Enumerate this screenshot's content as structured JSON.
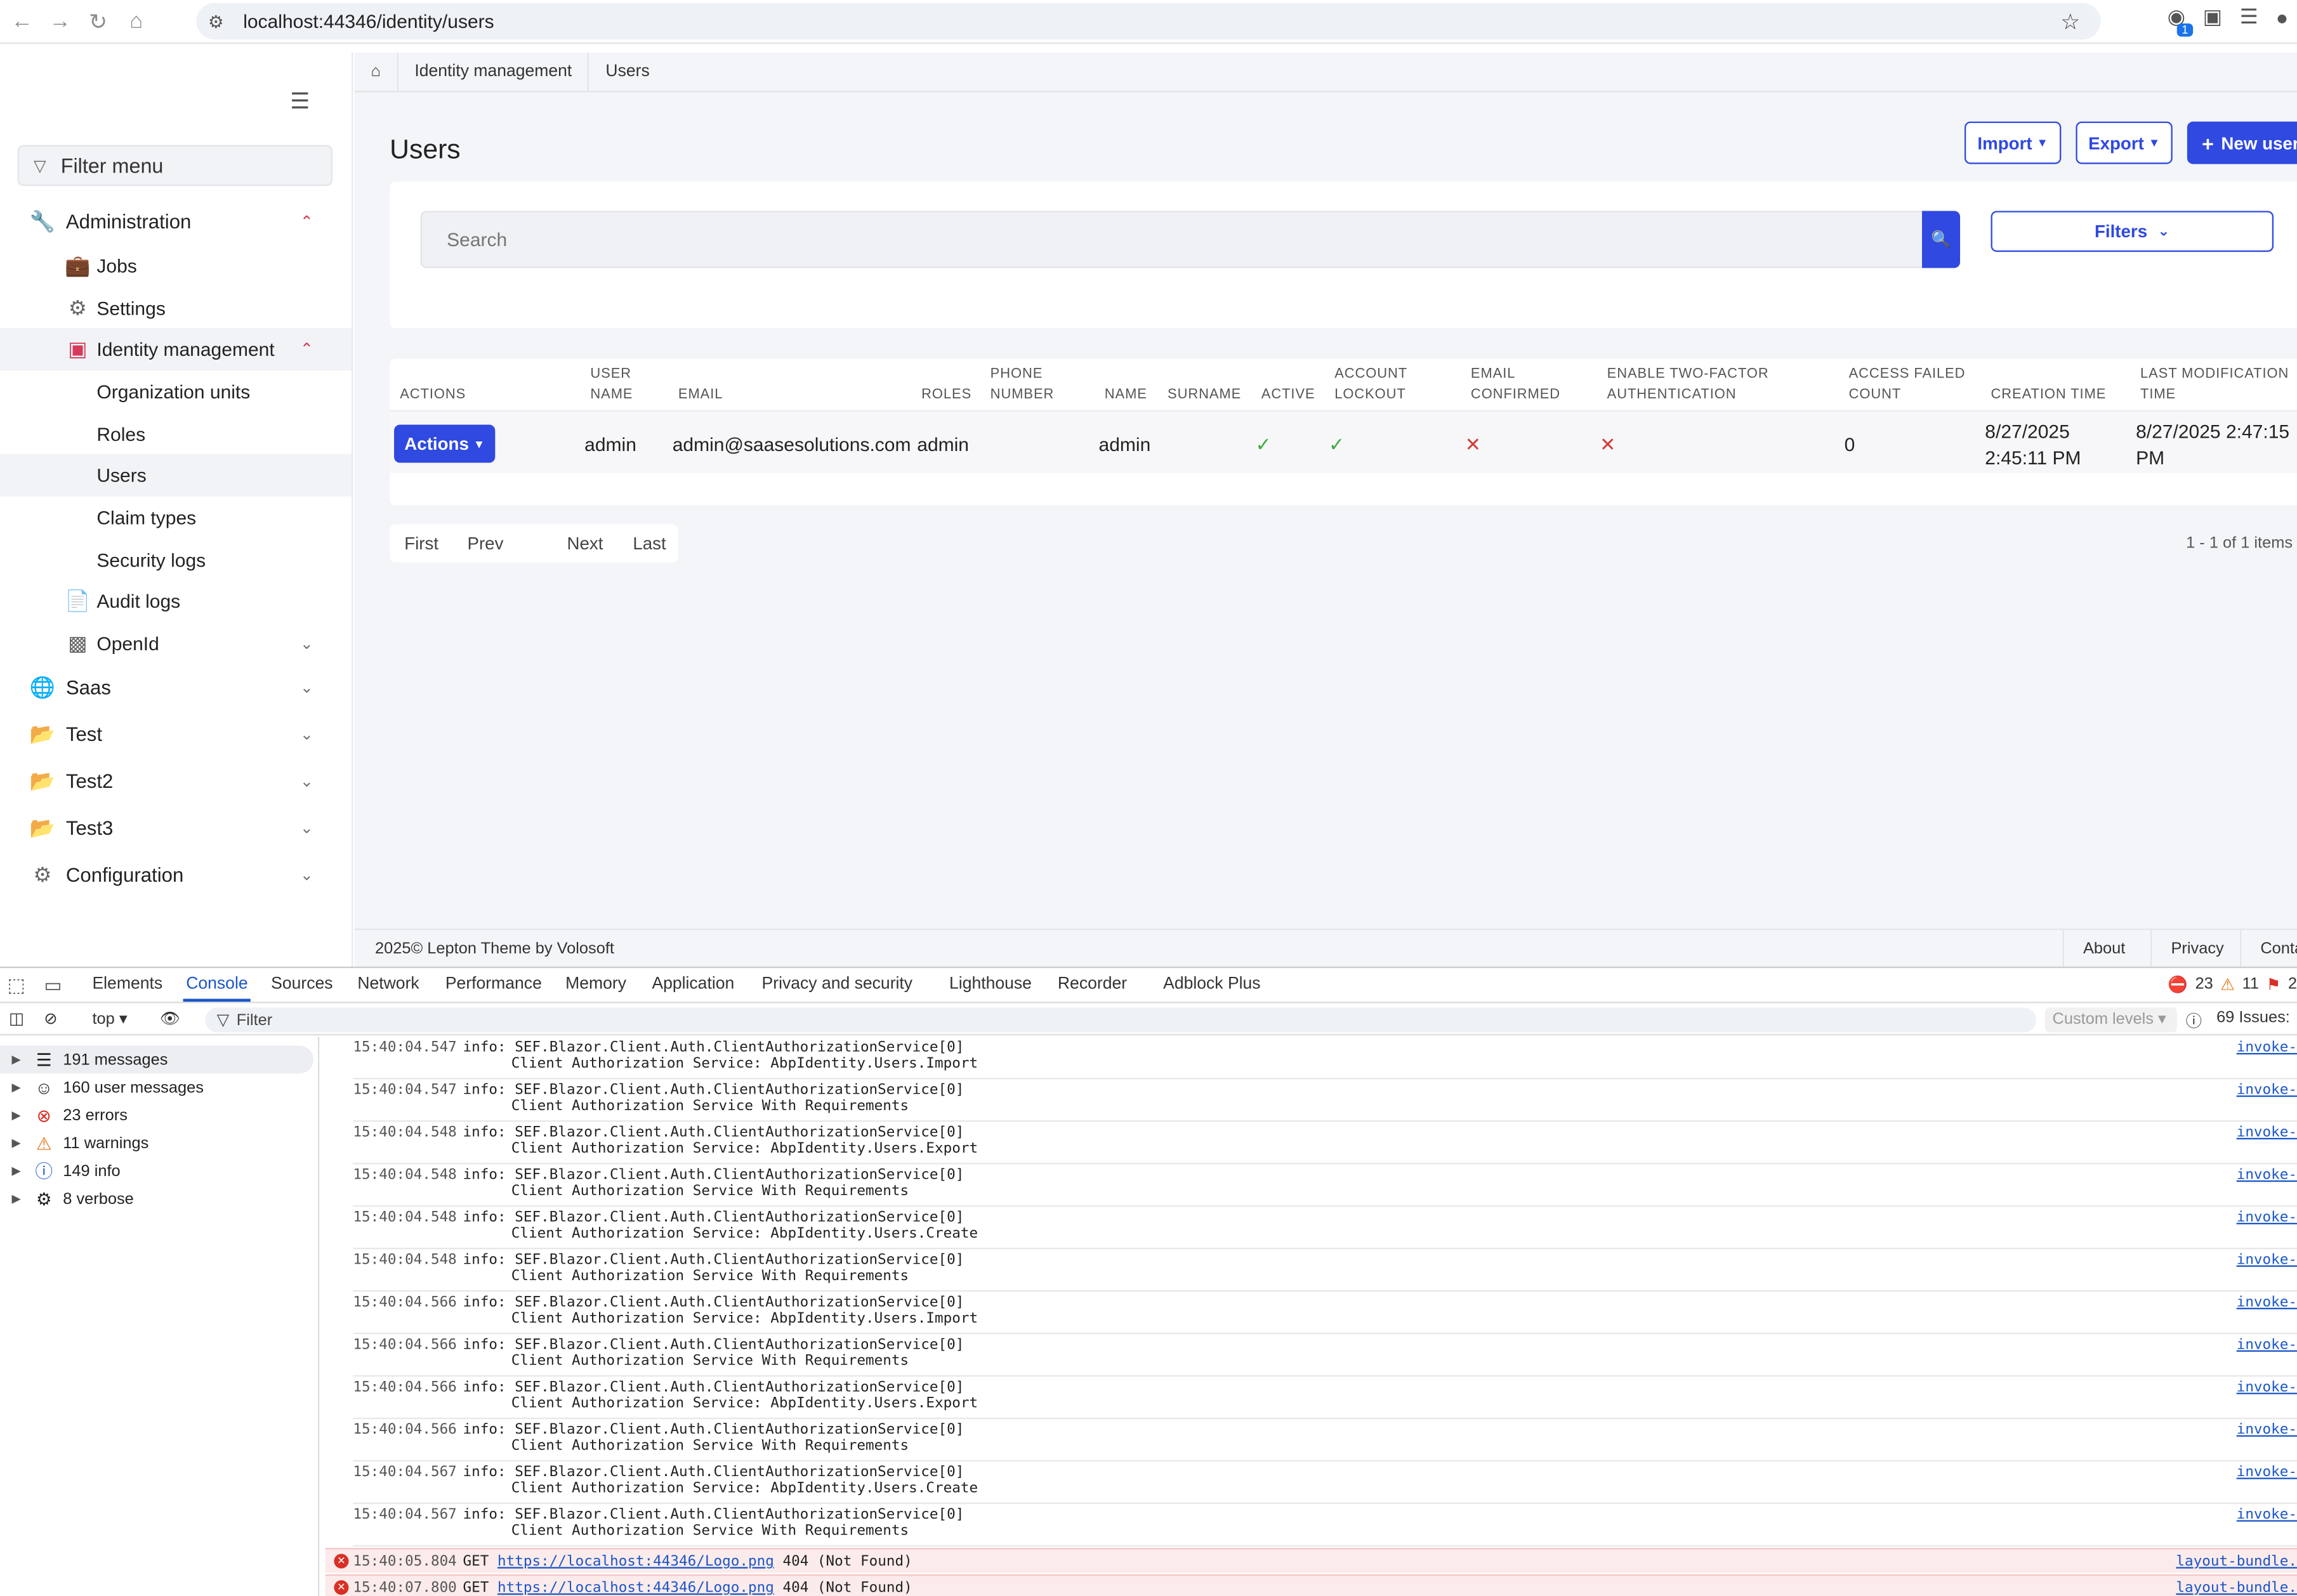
{
  "browser": {
    "url": "localhost:44346/identity/users",
    "extension_badge": "1"
  },
  "sidebar": {
    "filter_placeholder": "Filter menu",
    "items": [
      {
        "label": "Administration"
      },
      {
        "label": "Jobs"
      },
      {
        "label": "Settings"
      },
      {
        "label": "Identity management"
      },
      {
        "label": "Organization units"
      },
      {
        "label": "Roles"
      },
      {
        "label": "Users"
      },
      {
        "label": "Claim types"
      },
      {
        "label": "Security logs"
      },
      {
        "label": "Audit logs"
      },
      {
        "label": "OpenId"
      },
      {
        "label": "Saas"
      },
      {
        "label": "Test"
      },
      {
        "label": "Test2"
      },
      {
        "label": "Test3"
      },
      {
        "label": "Configuration"
      }
    ]
  },
  "breadcrumb": [
    "Identity management",
    "Users"
  ],
  "page": {
    "title": "Users",
    "import_label": "Import",
    "export_label": "Export",
    "new_user_label": "New user",
    "search_placeholder": "Search",
    "filters_label": "Filters"
  },
  "table": {
    "headers": {
      "actions": "ACTIONS",
      "user_name": [
        "USER",
        "NAME"
      ],
      "email": "EMAIL",
      "roles": "ROLES",
      "phone_number": [
        "PHONE",
        "NUMBER"
      ],
      "name": "NAME",
      "surname": "SURNAME",
      "active": "ACTIVE",
      "account_lockout": [
        "ACCOUNT",
        "LOCKOUT"
      ],
      "email_confirmed": [
        "EMAIL",
        "CONFIRMED"
      ],
      "two_factor": [
        "ENABLE TWO-FACTOR",
        "AUTHENTICATION"
      ],
      "access_failed": [
        "ACCESS FAILED",
        "COUNT"
      ],
      "creation_time": "CREATION TIME",
      "last_modification": [
        "LAST MODIFICATION",
        "TIME"
      ]
    },
    "rows": [
      {
        "actions_label": "Actions",
        "user_name": "admin",
        "email": "admin@saasesolutions.com",
        "roles": "admin",
        "phone_number": "",
        "name": "admin",
        "surname": "",
        "active": true,
        "account_lockout": true,
        "email_confirmed": false,
        "two_factor": false,
        "access_failed_count": "0",
        "creation_time": [
          "8/27/2025",
          "2:45:11 PM"
        ],
        "last_modification": [
          "8/27/2025 2:47:15",
          "PM"
        ]
      }
    ]
  },
  "pager": {
    "first": "First",
    "prev": "Prev",
    "next": "Next",
    "last": "Last",
    "summary": "1 - 1 of 1 items"
  },
  "footer": {
    "year": "2025©",
    "theme": "Lepton Theme",
    "by": "by",
    "vendor": "Volosoft",
    "links": [
      "About",
      "Privacy",
      "Conta"
    ]
  },
  "devtools": {
    "tabs": [
      "Elements",
      "Console",
      "Sources",
      "Network",
      "Performance",
      "Memory",
      "Application",
      "Privacy and security",
      "Lighthouse",
      "Recorder",
      "Adblock Plus"
    ],
    "active_tab": "Console",
    "errors_count": "23",
    "warnings_count": "11",
    "issues_count_badge": "2",
    "context": "top",
    "filter_placeholder": "Filter",
    "levels": "Custom levels",
    "issues": "69 Issues:",
    "sidebar": [
      {
        "label": "191 messages"
      },
      {
        "label": "160 user messages"
      },
      {
        "label": "23 errors"
      },
      {
        "label": "11 warnings"
      },
      {
        "label": "149 info"
      },
      {
        "label": "8 verbose"
      }
    ],
    "logs": [
      {
        "ts": "15:40:04.547",
        "l1": "info: SEF.Blazor.Client.Auth.ClientAuthorizationService[0]",
        "l2": "Client Authorization Service: AbpIdentity.Users.Import",
        "src": "invoke-"
      },
      {
        "ts": "15:40:04.547",
        "l1": "info: SEF.Blazor.Client.Auth.ClientAuthorizationService[0]",
        "l2": "Client Authorization Service With Requirements",
        "src": "invoke-"
      },
      {
        "ts": "15:40:04.548",
        "l1": "info: SEF.Blazor.Client.Auth.ClientAuthorizationService[0]",
        "l2": "Client Authorization Service: AbpIdentity.Users.Export",
        "src": "invoke-"
      },
      {
        "ts": "15:40:04.548",
        "l1": "info: SEF.Blazor.Client.Auth.ClientAuthorizationService[0]",
        "l2": "Client Authorization Service With Requirements",
        "src": "invoke-"
      },
      {
        "ts": "15:40:04.548",
        "l1": "info: SEF.Blazor.Client.Auth.ClientAuthorizationService[0]",
        "l2": "Client Authorization Service: AbpIdentity.Users.Create",
        "src": "invoke-"
      },
      {
        "ts": "15:40:04.548",
        "l1": "info: SEF.Blazor.Client.Auth.ClientAuthorizationService[0]",
        "l2": "Client Authorization Service With Requirements",
        "src": "invoke-"
      },
      {
        "ts": "15:40:04.566",
        "l1": "info: SEF.Blazor.Client.Auth.ClientAuthorizationService[0]",
        "l2": "Client Authorization Service: AbpIdentity.Users.Import",
        "src": "invoke-"
      },
      {
        "ts": "15:40:04.566",
        "l1": "info: SEF.Blazor.Client.Auth.ClientAuthorizationService[0]",
        "l2": "Client Authorization Service With Requirements",
        "src": "invoke-"
      },
      {
        "ts": "15:40:04.566",
        "l1": "info: SEF.Blazor.Client.Auth.ClientAuthorizationService[0]",
        "l2": "Client Authorization Service: AbpIdentity.Users.Export",
        "src": "invoke-"
      },
      {
        "ts": "15:40:04.566",
        "l1": "info: SEF.Blazor.Client.Auth.ClientAuthorizationService[0]",
        "l2": "Client Authorization Service With Requirements",
        "src": "invoke-"
      },
      {
        "ts": "15:40:04.567",
        "l1": "info: SEF.Blazor.Client.Auth.ClientAuthorizationService[0]",
        "l2": "Client Authorization Service: AbpIdentity.Users.Create",
        "src": "invoke-"
      },
      {
        "ts": "15:40:04.567",
        "l1": "info: SEF.Blazor.Client.Auth.ClientAuthorizationService[0]",
        "l2": "Client Authorization Service With Requirements",
        "src": "invoke-"
      }
    ],
    "errors": [
      {
        "ts": "15:40:05.804",
        "method": "GET",
        "url": "https://localhost:44346/Logo.png",
        "status": "404 (Not Found)",
        "src": "layout-bundle."
      },
      {
        "ts": "15:40:07.800",
        "method": "GET",
        "url": "https://localhost:44346/Logo.png",
        "status": "404 (Not Found)",
        "src": "layout-bundle."
      }
    ]
  },
  "colors": {
    "primary": "#2f49e1",
    "accent_red": "#d63a5a",
    "check_green": "#3aaa3a",
    "cross_red": "#d63a3a"
  }
}
